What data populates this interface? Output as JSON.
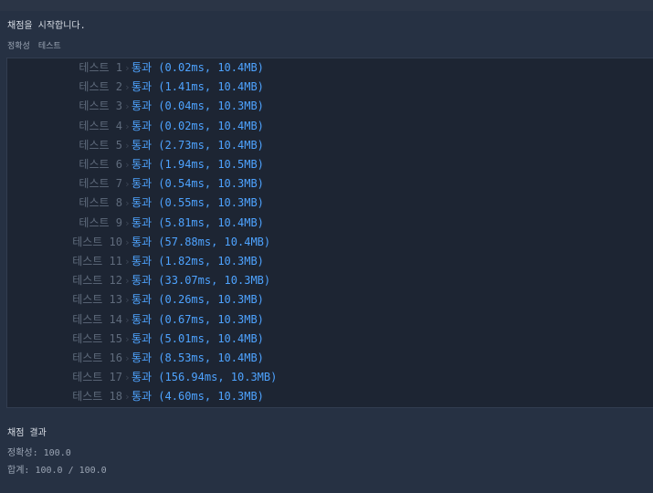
{
  "header": {
    "start_message": "채점을 시작합니다."
  },
  "section": {
    "label_accuracy": "정확성",
    "label_test": "테스트"
  },
  "tests": [
    {
      "name": "테스트 1",
      "result": "통과 (0.02ms, 10.4MB)"
    },
    {
      "name": "테스트 2",
      "result": "통과 (1.41ms, 10.4MB)"
    },
    {
      "name": "테스트 3",
      "result": "통과 (0.04ms, 10.3MB)"
    },
    {
      "name": "테스트 4",
      "result": "통과 (0.02ms, 10.4MB)"
    },
    {
      "name": "테스트 5",
      "result": "통과 (2.73ms, 10.4MB)"
    },
    {
      "name": "테스트 6",
      "result": "통과 (1.94ms, 10.5MB)"
    },
    {
      "name": "테스트 7",
      "result": "통과 (0.54ms, 10.3MB)"
    },
    {
      "name": "테스트 8",
      "result": "통과 (0.55ms, 10.3MB)"
    },
    {
      "name": "테스트 9",
      "result": "통과 (5.81ms, 10.4MB)"
    },
    {
      "name": "테스트 10",
      "result": "통과 (57.88ms, 10.4MB)"
    },
    {
      "name": "테스트 11",
      "result": "통과 (1.82ms, 10.3MB)"
    },
    {
      "name": "테스트 12",
      "result": "통과 (33.07ms, 10.3MB)"
    },
    {
      "name": "테스트 13",
      "result": "통과 (0.26ms, 10.3MB)"
    },
    {
      "name": "테스트 14",
      "result": "통과 (0.67ms, 10.3MB)"
    },
    {
      "name": "테스트 15",
      "result": "통과 (5.01ms, 10.4MB)"
    },
    {
      "name": "테스트 16",
      "result": "통과 (8.53ms, 10.4MB)"
    },
    {
      "name": "테스트 17",
      "result": "통과 (156.94ms, 10.3MB)"
    },
    {
      "name": "테스트 18",
      "result": "통과 (4.60ms, 10.3MB)"
    }
  ],
  "summary": {
    "title": "채점 결과",
    "accuracy": "정확성: 100.0",
    "total": "합계: 100.0 / 100.0"
  },
  "colors": {
    "background": "#263143",
    "results_background": "#1d2533",
    "pass_text": "#4ea3ff",
    "test_label": "#5f6b7c"
  }
}
